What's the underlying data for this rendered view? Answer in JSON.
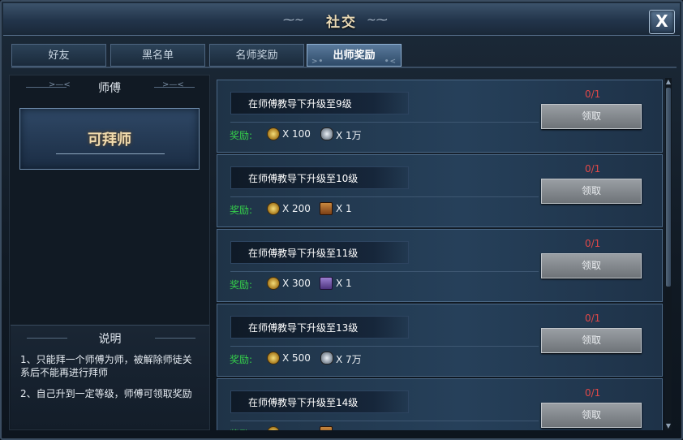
{
  "window": {
    "title": "社交",
    "close_label": "X"
  },
  "tabs": [
    {
      "label": "好友"
    },
    {
      "label": "黑名单"
    },
    {
      "label": "名师奖励"
    },
    {
      "label": "出师奖励",
      "active": true
    }
  ],
  "left": {
    "master_title": "师傅",
    "master_status": "可拜师",
    "desc_title": "说明",
    "desc_lines": [
      "1、只能拜一个师傅为师，被解除师徒关系后不能再进行拜师",
      "2、自己升到一定等级，师傅可领取奖励"
    ]
  },
  "rewards": {
    "label": "奖励:",
    "claim_label": "领取",
    "items": [
      {
        "task": "在师傅教导下升级至9级",
        "progress": "0/1",
        "r1_icon": "gold-coin-icon",
        "r1": "X 100",
        "r2_icon": "silver-icon",
        "r2": "X 1万"
      },
      {
        "task": "在师傅教导下升级至10级",
        "progress": "0/1",
        "r1_icon": "gold-coin-icon",
        "r1": "X 200",
        "r2_icon": "treasure-chest-icon",
        "r2": "X 1"
      },
      {
        "task": "在师傅教导下升级至11级",
        "progress": "0/1",
        "r1_icon": "gold-coin-icon",
        "r1": "X 300",
        "r2_icon": "purple-chest-icon",
        "r2": "X 1"
      },
      {
        "task": "在师傅教导下升级至13级",
        "progress": "0/1",
        "r1_icon": "gold-coin-icon",
        "r1": "X 500",
        "r2_icon": "silver-icon",
        "r2": "X 7万"
      },
      {
        "task": "在师傅教导下升级至14级",
        "progress": "0/1",
        "r1_icon": "gold-coin-icon",
        "r1": "",
        "r2_icon": "treasure-chest-icon",
        "r2": ""
      }
    ]
  },
  "colors": {
    "progress": "#e14848",
    "reward_label": "#35d04a",
    "title": "#e9d9b5"
  }
}
